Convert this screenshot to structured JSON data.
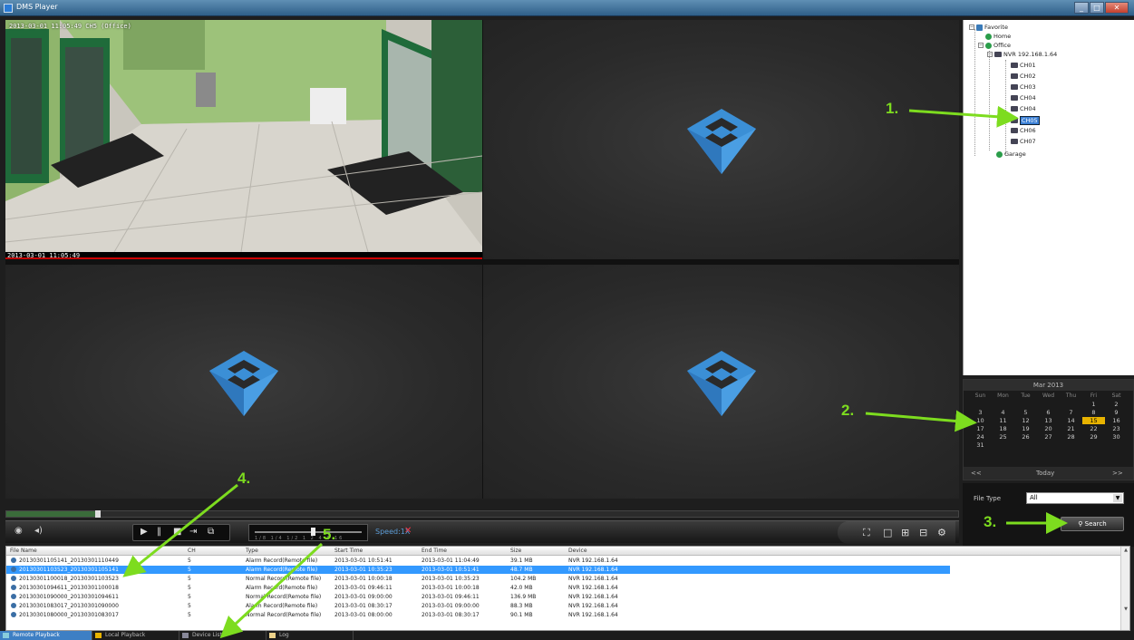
{
  "window": {
    "title": "DMS Player"
  },
  "panes": [
    {
      "osd_top": "2013-03-01 11:05:49  CH5  (Office)",
      "osd_bottom": "2013-03-01 11:05:49"
    },
    {},
    {},
    {}
  ],
  "toolbar": {
    "speed_label": "Speed:1X",
    "speed_ticks": "1/8 1/4 1/2 1 2 4 8 16"
  },
  "tree": {
    "root": "Favorite",
    "nodes": [
      {
        "label": "Home"
      },
      {
        "label": "Office"
      },
      {
        "label": "NVR  192.168.1.64"
      },
      {
        "label": "CH01"
      },
      {
        "label": "CH02"
      },
      {
        "label": "CH03"
      },
      {
        "label": "CH04"
      },
      {
        "label": "CH05"
      },
      {
        "label": "CH06"
      },
      {
        "label": "CH07"
      },
      {
        "label": "CH08"
      },
      {
        "label": "Garage"
      }
    ]
  },
  "calendar": {
    "month": "Mar 2013",
    "days": [
      "Sun",
      "Mon",
      "Tue",
      "Wed",
      "Thu",
      "Fri",
      "Sat"
    ],
    "dates": [
      "",
      "",
      "",
      "",
      "",
      "1",
      "2",
      "3",
      "4",
      "5",
      "6",
      "7",
      "8",
      "9",
      "10",
      "11",
      "12",
      "13",
      "14",
      "15",
      "16",
      "17",
      "18",
      "19",
      "20",
      "21",
      "22",
      "23",
      "24",
      "25",
      "26",
      "27",
      "28",
      "29",
      "30",
      "31"
    ],
    "highlighted": "15",
    "prev": "<<",
    "next": ">>",
    "today_label": "Today"
  },
  "search": {
    "filetype_label": "File Type",
    "filetype_value": "All",
    "button_label": "Search"
  },
  "filelist": {
    "columns": [
      "File Name",
      "CH",
      "Type",
      "Start Time",
      "End Time",
      "Size",
      "Device"
    ],
    "rows": [
      {
        "name": "20130301105141_20130301110449",
        "ch": "5",
        "type": "Alarm Record(Remote file)",
        "start": "2013-03-01 10:51:41",
        "end": "2013-03-01 11:04:49",
        "size": "39.1 MB",
        "device": "NVR 192.168.1.64"
      },
      {
        "name": "20130301103523_20130301105141",
        "ch": "5",
        "type": "Alarm Record(Remote file)",
        "start": "2013-03-01 10:35:23",
        "end": "2013-03-01 10:51:41",
        "size": "48.7 MB",
        "device": "NVR 192.168.1.64"
      },
      {
        "name": "20130301100018_20130301103523",
        "ch": "5",
        "type": "Normal Record(Remote file)",
        "start": "2013-03-01 10:00:18",
        "end": "2013-03-01 10:35:23",
        "size": "104.2 MB",
        "device": "NVR 192.168.1.64"
      },
      {
        "name": "20130301094611_20130301100018",
        "ch": "5",
        "type": "Alarm Record(Remote file)",
        "start": "2013-03-01 09:46:11",
        "end": "2013-03-01 10:00:18",
        "size": "42.0 MB",
        "device": "NVR 192.168.1.64"
      },
      {
        "name": "20130301090000_20130301094611",
        "ch": "5",
        "type": "Normal Record(Remote file)",
        "start": "2013-03-01 09:00:00",
        "end": "2013-03-01 09:46:11",
        "size": "136.9 MB",
        "device": "NVR 192.168.1.64"
      },
      {
        "name": "20130301083017_20130301090000",
        "ch": "5",
        "type": "Alarm Record(Remote file)",
        "start": "2013-03-01 08:30:17",
        "end": "2013-03-01 09:00:00",
        "size": "88.3 MB",
        "device": "NVR 192.168.1.64"
      },
      {
        "name": "20130301080000_20130301083017",
        "ch": "5",
        "type": "Normal Record(Remote file)",
        "start": "2013-03-01 08:00:00",
        "end": "2013-03-01 08:30:17",
        "size": "90.1 MB",
        "device": "NVR 192.168.1.64"
      }
    ],
    "selected_index": 1
  },
  "tabs": [
    {
      "label": "Remote Playback"
    },
    {
      "label": "Local Playback"
    },
    {
      "label": "Device List"
    },
    {
      "label": "Log"
    }
  ],
  "annotations": [
    "1.",
    "2.",
    "3.",
    "4.",
    "5."
  ],
  "colors": {
    "accent": "#3399ff",
    "annotation": "#7ddc1f",
    "logo": "#3b8fd6"
  }
}
